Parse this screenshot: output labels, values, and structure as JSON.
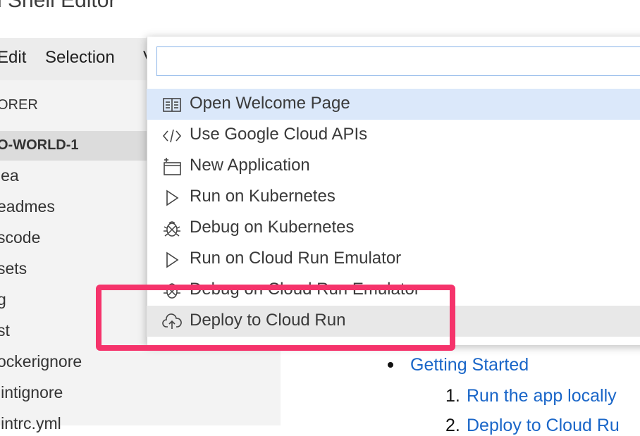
{
  "window": {
    "title": "d Shell Editor"
  },
  "menubar": {
    "items": [
      "Edit",
      "Selection",
      "V"
    ]
  },
  "explorer": {
    "header": "ORER",
    "folder": "O-WORLD-1",
    "items": [
      "lea",
      "eadmes",
      "scode",
      "sets",
      "g",
      "st",
      "ockerignore",
      "lintignore",
      "lintrc.yml"
    ]
  },
  "content": {
    "bullet_link": "Getting Started",
    "numbered": [
      {
        "number": "1.",
        "label": "Run the app locally"
      },
      {
        "number": "2.",
        "label": "Deploy to Cloud Ru"
      }
    ]
  },
  "palette": {
    "input_value": "",
    "items": [
      {
        "label": "Open Welcome Page",
        "icon": "book-icon"
      },
      {
        "label": "Use Google Cloud APIs",
        "icon": "code-icon"
      },
      {
        "label": "New Application",
        "icon": "new-app-icon"
      },
      {
        "label": "Run on Kubernetes",
        "icon": "play-icon"
      },
      {
        "label": "Debug on Kubernetes",
        "icon": "bug-icon"
      },
      {
        "label": "Run on Cloud Run Emulator",
        "icon": "play-icon"
      },
      {
        "label": "Debug on Cloud Run Emulator",
        "icon": "bug-icon"
      },
      {
        "label": "Deploy to Cloud Run",
        "icon": "cloud-upload-icon"
      }
    ]
  },
  "colors": {
    "link": "#1a66c8",
    "callout": "#f5336b",
    "highlight": "#dbe8fa"
  }
}
